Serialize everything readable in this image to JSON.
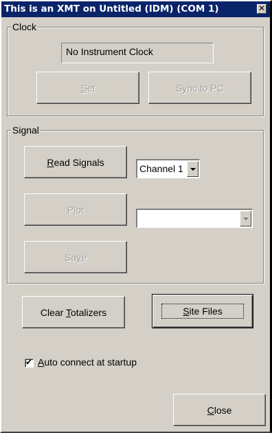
{
  "window": {
    "title": "This is an XMT on Untitled (IDM) (COM 1)",
    "close_glyph": "✕"
  },
  "clock": {
    "group_label": "Clock",
    "status": "No Instrument Clock",
    "set_button": {
      "pre": "",
      "key": "S",
      "post": "et",
      "enabled": false
    },
    "sync_button": {
      "pre": "S",
      "key": "y",
      "post": "nc to PC",
      "enabled": false
    }
  },
  "signal": {
    "group_label": "Signal",
    "read_button": {
      "pre": "",
      "key": "R",
      "post": "ead Signals",
      "enabled": true
    },
    "plot_button": {
      "pre": "P",
      "key": "l",
      "post": "ot",
      "enabled": false
    },
    "save_button": {
      "pre": "Sa",
      "key": "v",
      "post": "e",
      "enabled": false
    },
    "channel_select": {
      "value": "Channel 1",
      "enabled": true
    },
    "plot_select": {
      "value": "",
      "enabled": false
    }
  },
  "bottom": {
    "clear_button": {
      "pre": "Clear ",
      "key": "T",
      "post": "otalizers"
    },
    "site_button": {
      "pre": "",
      "key": "S",
      "post": "ite Files"
    },
    "auto_connect": {
      "checked": true,
      "check_glyph": "✔",
      "pre": "",
      "key": "A",
      "post": "uto connect at startup"
    },
    "close_button": {
      "pre": "",
      "key": "C",
      "post": "lose"
    }
  }
}
